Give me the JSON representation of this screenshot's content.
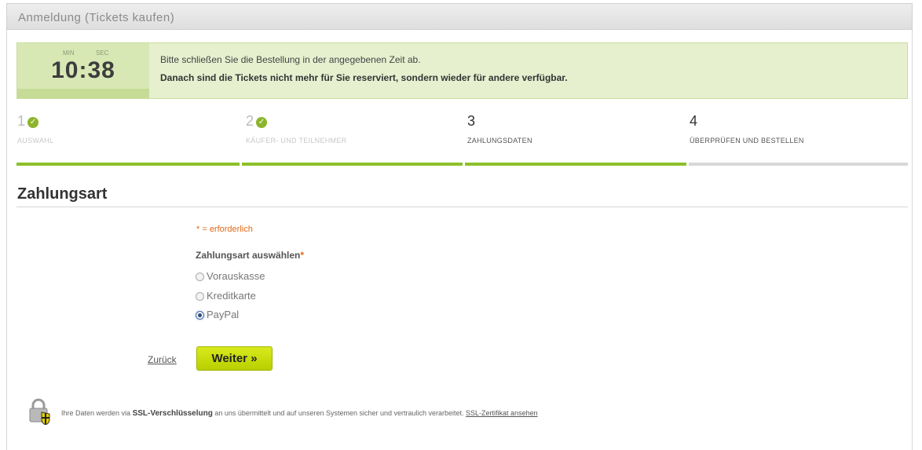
{
  "window": {
    "title": "Anmeldung (Tickets kaufen)"
  },
  "timer": {
    "min_label": "MIN",
    "sec_label": "SEC",
    "time": "10:38",
    "message_line1": "Bitte schließen Sie die Bestellung in der angegebenen Zeit ab.",
    "message_line2": "Danach sind die Tickets nicht mehr für Sie reserviert, sondern wieder für andere verfügbar."
  },
  "steps": [
    {
      "number": "1",
      "label": "AUSWAHL",
      "status": "done"
    },
    {
      "number": "2",
      "label": "KÄUFER- UND TEILNEHMER",
      "status": "done"
    },
    {
      "number": "3",
      "label": "ZAHLUNGSDATEN",
      "status": "active"
    },
    {
      "number": "4",
      "label": "ÜBERPRÜFEN UND BESTELLEN",
      "status": "todo"
    }
  ],
  "section": {
    "title": "Zahlungsart"
  },
  "form": {
    "required_note": "* = erforderlich",
    "field_label": "Zahlungsart auswählen",
    "required_star": "*",
    "options": [
      {
        "label": "Vorauskasse",
        "selected": false
      },
      {
        "label": "Kreditkarte",
        "selected": false
      },
      {
        "label": "PayPal",
        "selected": true
      }
    ]
  },
  "actions": {
    "back_label": "Zurück",
    "next_label": "Weiter »"
  },
  "footer": {
    "text_before": "Ihre Daten werden via",
    "text_bold": "SSL-Verschlüsselung",
    "text_after": "an uns übermittelt und auf unseren Systemen sicher und vertraulich verarbeitet.",
    "link_label": "SSL-Zertifikat ansehen"
  },
  "colors": {
    "accent": "#8cc02a",
    "button": "#c8dc00",
    "timer_bg": "#e6f0cf",
    "required": "#e06a19"
  }
}
